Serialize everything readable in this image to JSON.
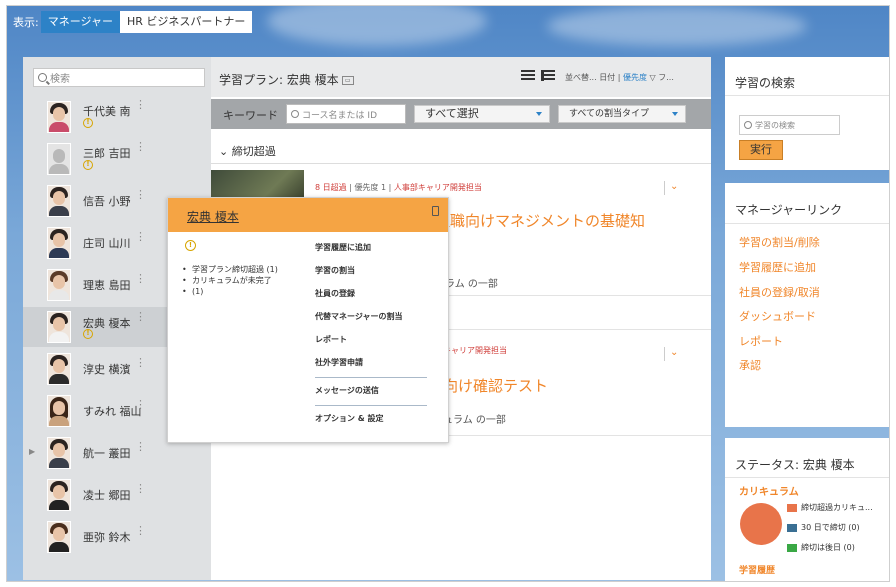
{
  "topbar": {
    "show_label": "表示:",
    "tabs": [
      {
        "label": "マネージャー",
        "active": true
      },
      {
        "label": "HR ビジネスパートナー",
        "active": false
      }
    ]
  },
  "left": {
    "search_placeholder": "検索",
    "people": [
      {
        "name": "千代美 南",
        "warning": true
      },
      {
        "name": "三郎 吉田",
        "warning": true
      },
      {
        "name": "信吾 小野",
        "warning": false
      },
      {
        "name": "庄司 山川",
        "warning": false
      },
      {
        "name": "理恵 島田",
        "warning": false
      },
      {
        "name": "宏典 榎本",
        "warning": true
      },
      {
        "name": "淳史 横濱",
        "warning": false
      },
      {
        "name": "すみれ 福山",
        "warning": false
      },
      {
        "name": "航一 叢田",
        "warning": false
      },
      {
        "name": "凌士 郷田",
        "warning": false
      },
      {
        "name": "亜弥 鈴木",
        "warning": false
      }
    ]
  },
  "center": {
    "title": "学習プラン: 宏典 榎本",
    "sort": {
      "prefix": "並べ替...",
      "date": "日付",
      "sep": "|",
      "priority": "優先度",
      "filter": "フ..."
    },
    "keyword_label": "キーワード",
    "keyword_placeholder": "コース名または ID",
    "select_all": "すべて選択",
    "assignment_type": "すべての割当タイプ",
    "section": "締切超過",
    "item1": {
      "overdue": "8 日超過",
      "sep1": "|",
      "priority": "優先度 1",
      "sep2": "|",
      "dept": "人事部キャリア開発担当",
      "title_visible": "理職向けマネジメントの基礎知",
      "partof_visible": "ュラム の一部"
    },
    "item2": {
      "dept_visible": "キャリア開発担当",
      "title_visible": "向け確認テスト",
      "partof_visible": "ュラム の一部"
    }
  },
  "popup": {
    "name": "宏典 榎本",
    "bullets": [
      "学習プラン締切超過 (1)",
      "カリキュラムが未完了",
      "(1)"
    ],
    "actions": [
      "学習履歴に追加",
      "学習の割当",
      "社員の登録",
      "代替マネージャーの割当",
      "レポート",
      "社外学習申請",
      "メッセージの送信",
      "オプション & 設定"
    ]
  },
  "right": {
    "search_title": "学習の検索",
    "search_placeholder": "学習の検索",
    "run": "実行",
    "links_title": "マネージャーリンク",
    "links": [
      "学習の割当/削除",
      "学習履歴に追加",
      "社員の登録/取消",
      "ダッシュボード",
      "レポート",
      "承認"
    ],
    "status_title": "ステータス: 宏典 榎本",
    "curriculum": "カリキュラム",
    "legend": [
      {
        "label": "締切超過カリキュ...",
        "color": "#e8744a"
      },
      {
        "label": "30 日で締切 (0)",
        "color": "#3a6f93"
      },
      {
        "label": "締切は後日 (0)",
        "color": "#3aa845"
      }
    ],
    "learning_history": "学習履歴"
  },
  "colors": {
    "accent": "#f0862a",
    "tab_blue": "#2d82c7",
    "popup_header": "#f5a444"
  }
}
